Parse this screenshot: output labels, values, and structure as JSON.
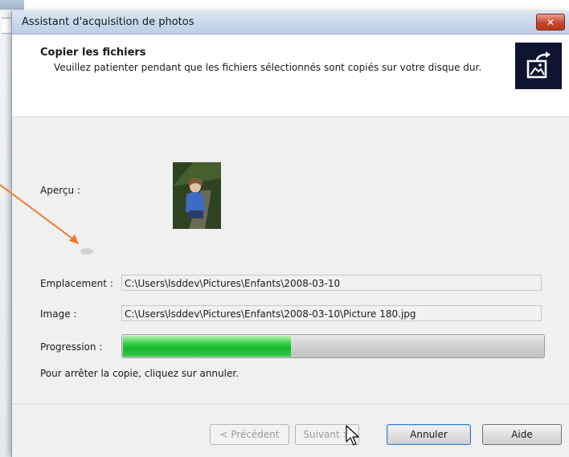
{
  "window": {
    "title": "Assistant d'acquisition de photos",
    "close_glyph": "✕"
  },
  "header": {
    "title": "Copier les fichiers",
    "description": "Veuillez patienter pendant que les fichiers sélectionnés sont copiés sur votre disque dur.",
    "icon": "photo-import-icon"
  },
  "preview": {
    "label": "Aperçu :"
  },
  "fields": {
    "location_label": "Emplacement :",
    "location_value": "C:\\Users\\lsddev\\Pictures\\Enfants\\2008-03-10",
    "image_label": "Image :",
    "image_value": "C:\\Users\\lsddev\\Pictures\\Enfants\\2008-03-10\\Picture 180.jpg"
  },
  "progress": {
    "label": "Progression :",
    "fraction": 0.4
  },
  "hint": "Pour arrêter la copie, cliquez sur annuler.",
  "buttons": {
    "previous": "< Précédent",
    "next": "Suivant >",
    "cancel": "Annuler",
    "help": "Aide"
  },
  "colors": {
    "annotation_arrow": "#f07a2a",
    "progress_green": "#14b52a",
    "close_red": "#c9442b"
  }
}
